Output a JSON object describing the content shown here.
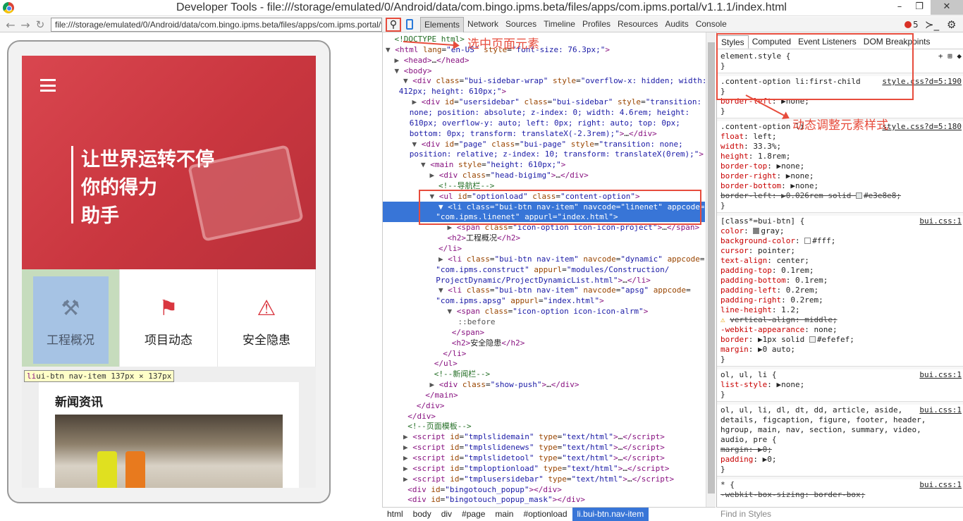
{
  "window": {
    "title": "Developer Tools - file:///storage/emulated/0/Android/data/com.bingo.ipms.beta/files/apps/com.ipms.portal/v1.1.1/index.html",
    "min": "–",
    "max": "❐",
    "close": "✕"
  },
  "toolbar": {
    "url": "file:///storage/emulated/0/Android/data/com.bingo.ipms.beta/files/apps/com.ipms.portal/v1.1.1/index.html",
    "back": "←",
    "forward": "→",
    "error_count": "5"
  },
  "tabs": [
    "Elements",
    "Network",
    "Sources",
    "Timeline",
    "Profiles",
    "Resources",
    "Audits",
    "Console"
  ],
  "page": {
    "hero_lines": [
      "让世界运转不停",
      "你的得力",
      "助手"
    ],
    "menu": [
      {
        "label": "工程概况",
        "icon": "worker-icon"
      },
      {
        "label": "项目动态",
        "icon": "flag-icon"
      },
      {
        "label": "安全隐患",
        "icon": "warning-icon"
      }
    ],
    "news_title": "新闻资讯",
    "tooltip_tag": "li",
    "tooltip_cls": "ui-btn nav-item",
    "tooltip_size": "137px × 137px"
  },
  "annotations": {
    "select": "选中页面元素",
    "adjust": "动态调整元素样式"
  },
  "dom_lines": [
    {
      "i": 1,
      "t": "",
      "h": "<span class='cm'>&lt;!DOCTYPE html&gt;</span>"
    },
    {
      "i": 0,
      "t": "▼",
      "h": "<span class='tag'>&lt;html</span> <span class='an'>lang</span>=<span class='av'>\"en-US\"</span> <span class='an'>style</span>=<span class='av'>\"font-size: 76.3px;\"</span><span class='tag'>&gt;</span>"
    },
    {
      "i": 1,
      "t": "▶",
      "h": "<span class='tag'>&lt;head&gt;</span>…<span class='tag'>&lt;/head&gt;</span>"
    },
    {
      "i": 1,
      "t": "▼",
      "h": "<span class='tag'>&lt;body&gt;</span>"
    },
    {
      "i": 2,
      "t": "▼",
      "h": "<span class='tag'>&lt;div</span> <span class='an'>class</span>=<span class='av'>\"bui-sidebar-wrap\"</span> <span class='an'>style</span>=<span class='av'>\"overflow-x: hidden; width:</span>"
    },
    {
      "i": 1.5,
      "t": "",
      "h": "<span class='av'>412px; height: 610px;\"</span><span class='tag'>&gt;</span>"
    },
    {
      "i": 3,
      "t": "▶",
      "h": "<span class='tag'>&lt;div</span> <span class='an'>id</span>=<span class='av'>\"usersidebar\"</span> <span class='an'>class</span>=<span class='av'>\"bui-sidebar\"</span> <span class='an'>style</span>=<span class='av'>\"transition:</span>"
    },
    {
      "i": 2.7,
      "t": "",
      "h": "<span class='av'>none; position: absolute; z-index: 0; width: 4.6rem; height:</span>"
    },
    {
      "i": 2.7,
      "t": "",
      "h": "<span class='av'>610px; overflow-y: auto; left: 0px; right: auto; top: 0px;</span>"
    },
    {
      "i": 2.7,
      "t": "",
      "h": "<span class='av'>bottom: 0px; transform: translateX(-2.3rem);\"</span><span class='tag'>&gt;</span>…<span class='tag'>&lt;/div&gt;</span>"
    },
    {
      "i": 3,
      "t": "▼",
      "h": "<span class='tag'>&lt;div</span> <span class='an'>id</span>=<span class='av'>\"page\"</span> <span class='an'>class</span>=<span class='av'>\"bui-page\"</span> <span class='an'>style</span>=<span class='av'>\"transition: none;</span>"
    },
    {
      "i": 2.7,
      "t": "",
      "h": "<span class='av'>position: relative; z-index: 10; transform: translateX(0rem);\"</span><span class='tag'>&gt;</span>"
    },
    {
      "i": 4,
      "t": "▼",
      "h": "<span class='tag'>&lt;main</span> <span class='an'>style</span>=<span class='av'>\"height: 610px;\"</span><span class='tag'>&gt;</span>"
    },
    {
      "i": 5,
      "t": "▶",
      "h": "<span class='tag'>&lt;div</span> <span class='an'>class</span>=<span class='av'>\"head-bigimg\"</span><span class='tag'>&gt;</span>…<span class='tag'>&lt;/div&gt;</span>"
    },
    {
      "i": 6,
      "t": "",
      "h": "<span class='cm'>&lt;!--导航栏--&gt;</span>"
    },
    {
      "i": 5,
      "t": "▼",
      "h": "<span class='tag'>&lt;ul</span> <span class='an'>id</span>=<span class='av'>\"optionload\"</span> <span class='an'>class</span>=<span class='av'>\"content-option\"</span><span class='tag'>&gt;</span>"
    },
    {
      "i": 6,
      "t": "▼",
      "sel": true,
      "h": "<span class='tag'>&lt;li</span> <span class='an'>class</span>=<span class='av'>\"bui-btn nav-item\"</span> <span class='an'>navcode</span>=<span class='av'>\"linenet\"</span> <span class='an'>appcode</span>="
    },
    {
      "i": 5.7,
      "t": "",
      "sel": true,
      "h": "<span class='av'>\"com.ipms.linenet\"</span> <span class='an'>appurl</span>=<span class='av'>\"index.html\"</span><span class='tag'>&gt;</span>"
    },
    {
      "i": 7,
      "t": "▶",
      "h": "<span class='tag'>&lt;span</span> <span class='an'>class</span>=<span class='av'>\"icon-option icon-icon-project\"</span><span class='tag'>&gt;</span>…<span class='tag'>&lt;/span&gt;</span>"
    },
    {
      "i": 7,
      "t": "",
      "h": "<span class='tag'>&lt;h2&gt;</span>工程概况<span class='tag'>&lt;/h2&gt;</span>"
    },
    {
      "i": 6,
      "t": "",
      "h": "<span class='tag'>&lt;/li&gt;</span>"
    },
    {
      "i": 6,
      "t": "▶",
      "h": "<span class='tag'>&lt;li</span> <span class='an'>class</span>=<span class='av'>\"bui-btn nav-item\"</span> <span class='an'>navcode</span>=<span class='av'>\"dynamic\"</span> <span class='an'>appcode</span>="
    },
    {
      "i": 5.7,
      "t": "",
      "h": "<span class='av'>\"com.ipms.construct\"</span> <span class='an'>appurl</span>=<span class='av'>\"modules/Construction/</span>"
    },
    {
      "i": 5.7,
      "t": "",
      "h": "<span class='av'>ProjectDynamic/ProjectDynamicList.html\"</span><span class='tag'>&gt;</span>…<span class='tag'>&lt;/li&gt;</span>"
    },
    {
      "i": 6,
      "t": "▼",
      "h": "<span class='tag'>&lt;li</span> <span class='an'>class</span>=<span class='av'>\"bui-btn nav-item\"</span> <span class='an'>navcode</span>=<span class='av'>\"apsg\"</span> <span class='an'>appcode</span>="
    },
    {
      "i": 5.7,
      "t": "",
      "h": "<span class='av'>\"com.ipms.apsg\"</span> <span class='an'>appurl</span>=<span class='av'>\"index.html\"</span><span class='tag'>&gt;</span>"
    },
    {
      "i": 7,
      "t": "▼",
      "h": "<span class='tag'>&lt;span</span> <span class='an'>class</span>=<span class='av'>\"icon-option icon-icon-alrm\"</span><span class='tag'>&gt;</span>"
    },
    {
      "i": 8.2,
      "t": "",
      "h": "<span class='tri'>::before</span>"
    },
    {
      "i": 7.5,
      "t": "",
      "h": "<span class='tag'>&lt;/span&gt;</span>"
    },
    {
      "i": 7.5,
      "t": "",
      "h": "<span class='tag'>&lt;h2&gt;</span>安全隐患<span class='tag'>&lt;/h2&gt;</span>"
    },
    {
      "i": 6.5,
      "t": "",
      "h": "<span class='tag'>&lt;/li&gt;</span>"
    },
    {
      "i": 5.5,
      "t": "",
      "h": "<span class='tag'>&lt;/ul&gt;</span>"
    },
    {
      "i": 5.5,
      "t": "",
      "h": "<span class='cm'>&lt;!--新闻栏--&gt;</span>"
    },
    {
      "i": 5,
      "t": "▶",
      "h": "<span class='tag'>&lt;div</span> <span class='an'>class</span>=<span class='av'>\"show-push\"</span><span class='tag'>&gt;</span>…<span class='tag'>&lt;/div&gt;</span>"
    },
    {
      "i": 4.5,
      "t": "",
      "h": "<span class='tag'>&lt;/main&gt;</span>"
    },
    {
      "i": 3.5,
      "t": "",
      "h": "<span class='tag'>&lt;/div&gt;</span>"
    },
    {
      "i": 2.5,
      "t": "",
      "h": "<span class='tag'>&lt;/div&gt;</span>"
    },
    {
      "i": 2.5,
      "t": "",
      "h": "<span class='cm'>&lt;!--页面模板--&gt;</span>"
    },
    {
      "i": 2,
      "t": "▶",
      "h": "<span class='tag'>&lt;script</span> <span class='an'>id</span>=<span class='av'>\"tmplslidemain\"</span> <span class='an'>type</span>=<span class='av'>\"text/html\"</span><span class='tag'>&gt;</span>…<span class='tag'>&lt;/script&gt;</span>"
    },
    {
      "i": 2,
      "t": "▶",
      "h": "<span class='tag'>&lt;script</span> <span class='an'>id</span>=<span class='av'>\"tmplslidenews\"</span> <span class='an'>type</span>=<span class='av'>\"text/html\"</span><span class='tag'>&gt;</span>…<span class='tag'>&lt;/script&gt;</span>"
    },
    {
      "i": 2,
      "t": "▶",
      "h": "<span class='tag'>&lt;script</span> <span class='an'>id</span>=<span class='av'>\"tmplslidetool\"</span> <span class='an'>type</span>=<span class='av'>\"text/html\"</span><span class='tag'>&gt;</span>…<span class='tag'>&lt;/script&gt;</span>"
    },
    {
      "i": 2,
      "t": "▶",
      "h": "<span class='tag'>&lt;script</span> <span class='an'>id</span>=<span class='av'>\"tmploptionload\"</span> <span class='an'>type</span>=<span class='av'>\"text/html\"</span><span class='tag'>&gt;</span>…<span class='tag'>&lt;/script&gt;</span>"
    },
    {
      "i": 2,
      "t": "▶",
      "h": "<span class='tag'>&lt;script</span> <span class='an'>id</span>=<span class='av'>\"tmplusersidebar\"</span> <span class='an'>type</span>=<span class='av'>\"text/html\"</span><span class='tag'>&gt;</span>…<span class='tag'>&lt;/script&gt;</span>"
    },
    {
      "i": 2.5,
      "t": "",
      "h": "<span class='tag'>&lt;div</span> <span class='an'>id</span>=<span class='av'>\"bingotouch_popup\"</span><span class='tag'>&gt;&lt;/div&gt;</span>"
    },
    {
      "i": 2.5,
      "t": "",
      "h": "<span class='tag'>&lt;div</span> <span class='an'>id</span>=<span class='av'>\"bingotouch_popup_mask\"</span><span class='tag'>&gt;&lt;/div&gt;</span>"
    }
  ],
  "breadcrumbs": [
    "html",
    "body",
    "div",
    "#page",
    "main",
    "#optionload",
    "li.bui-btn.nav-item"
  ],
  "style_tabs": [
    "Styles",
    "Computed",
    "Event Listeners",
    "DOM Breakpoints"
  ],
  "style_lines": [
    {
      "h": "element.style {",
      "right": "+ ⊞ ◆"
    },
    {
      "h": "}"
    },
    {
      "sep": true
    },
    {
      "h": ".content-option li:first-child",
      "src": "style.css?d=5:190"
    },
    {
      "h": "}"
    },
    {
      "h": "    <span class='pn'>border-left</span>: ▶none;"
    },
    {
      "h": "}"
    },
    {
      "sep": true
    },
    {
      "h": ".content-option li",
      "src": "style.css?d=5:180"
    },
    {
      "h": "    <span class='pn'>float</span>: left;"
    },
    {
      "h": "    <span class='pn'>width</span>: 33.3%;"
    },
    {
      "h": "    <span class='pn'>height</span>: 1.8rem;"
    },
    {
      "h": "    <span class='pn'>border-top</span>: ▶none;"
    },
    {
      "h": "    <span class='pn'>border-right</span>: ▶none;"
    },
    {
      "h": "    <span class='pn'>border-bottom</span>: ▶none;"
    },
    {
      "h": "    <span class='strike'>border-left: ▶0.026rem solid <span class='sw' style='background:#e3e8e8'></span>#e3e8e8;</span>"
    },
    {
      "h": "}"
    },
    {
      "sep": true
    },
    {
      "h": "[class*=bui-btn] {",
      "src": "bui.css:1"
    },
    {
      "h": "    <span class='pn'>color</span>: <span class='sw' style='background:gray'></span>gray;"
    },
    {
      "h": "    <span class='pn'>background-color</span>: <span class='sw' style='background:#fff'></span>#fff;"
    },
    {
      "h": "    <span class='pn'>cursor</span>: pointer;"
    },
    {
      "h": "    <span class='pn'>text-align</span>: center;"
    },
    {
      "h": "    <span class='pn'>padding-top</span>: 0.1rem;"
    },
    {
      "h": "    <span class='pn'>padding-bottom</span>: 0.1rem;"
    },
    {
      "h": "    <span class='pn'>padding-left</span>: 0.2rem;"
    },
    {
      "h": "    <span class='pn'>padding-right</span>: 0.2rem;"
    },
    {
      "h": "    <span class='pn'>line-height</span>: 1.2;"
    },
    {
      "h": "<span style='color:#e8a200'>⚠</span>   <span class='strike'>vertical-align: middle;</span>"
    },
    {
      "h": "    <span class='pn'>-webkit-appearance</span>: none;"
    },
    {
      "h": "    <span class='pn'>border</span>: ▶1px solid <span class='sw' style='background:#efefef'></span>#efefef;"
    },
    {
      "h": "    <span class='pn'>margin</span>: ▶0 auto;"
    },
    {
      "h": "}"
    },
    {
      "sep": true
    },
    {
      "h": "ol, ul, li {",
      "src": "bui.css:1"
    },
    {
      "h": "    <span class='pn'>list-style</span>: ▶none;"
    },
    {
      "h": "}"
    },
    {
      "sep": true
    },
    {
      "h": "ol, ul, li, dl, dt, dd, article, aside,",
      "src": "bui.css:1"
    },
    {
      "h": "details, figcaption, figure, footer, header,"
    },
    {
      "h": "hgroup, main, nav, section, summary, video,"
    },
    {
      "h": "audio, pre {"
    },
    {
      "h": "    <span class='strike'>margin: ▶0;</span>"
    },
    {
      "h": "    <span class='pn'>padding</span>: ▶0;"
    },
    {
      "h": "}"
    },
    {
      "sep": true
    },
    {
      "h": "* {",
      "src": "bui.css:1"
    },
    {
      "h": "    <span class='strike'>-webkit-box-sizing: border-box;</span>"
    }
  ],
  "find_placeholder": "Find in Styles",
  "colors": {
    "accent": "#3875d7",
    "annotation": "#e74c3c",
    "hero": "#c9363f"
  }
}
